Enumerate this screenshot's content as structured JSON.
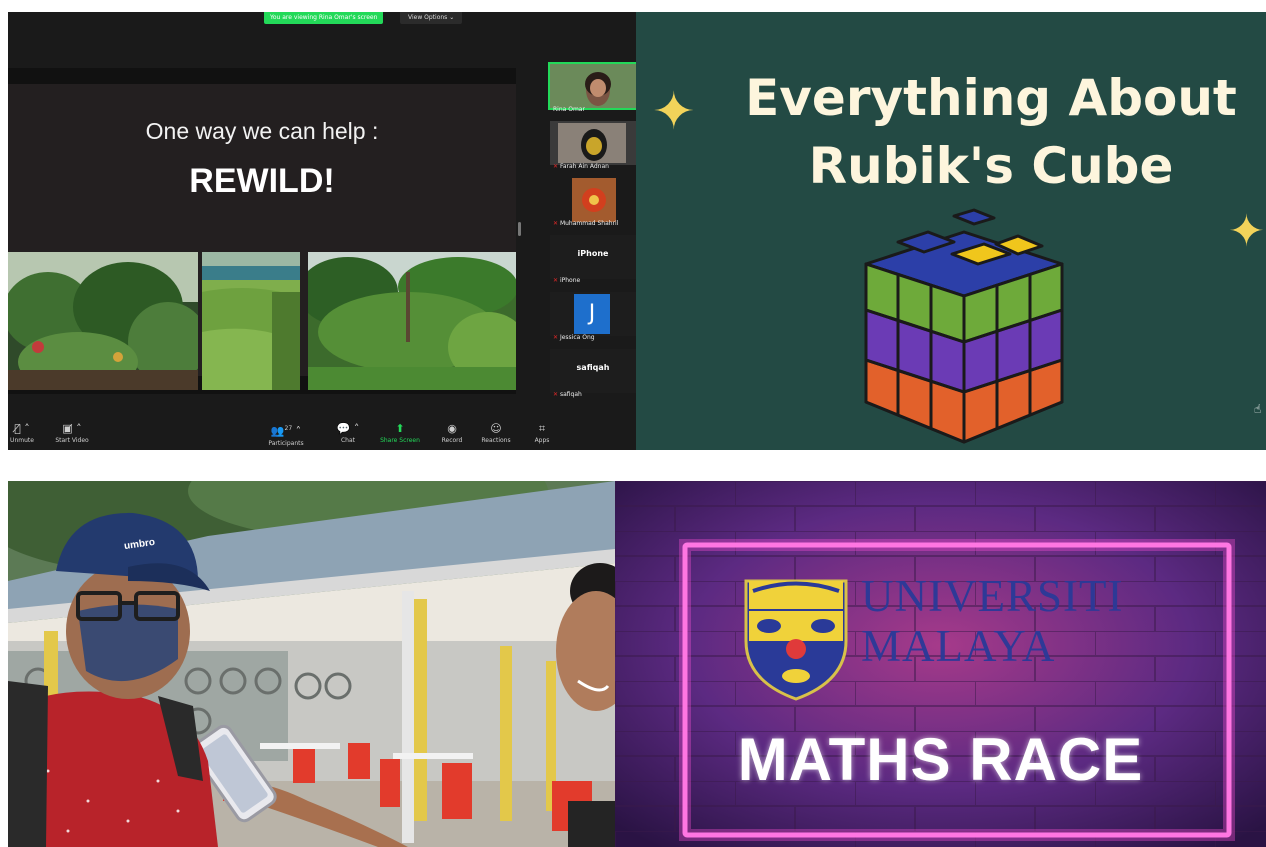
{
  "zoom": {
    "viewing_banner": "You are viewing Rina Omar's screen",
    "view_options": "View Options",
    "slide": {
      "subtitle": "One way we can help :",
      "title": "REWILD!"
    },
    "participants": [
      {
        "name": "Rina Omar",
        "type": "video",
        "active": true
      },
      {
        "name": "Farah Ain Adnan",
        "type": "video"
      },
      {
        "name": "Muhammad Shahril",
        "type": "video"
      },
      {
        "name": "iPhone",
        "type": "text",
        "display": "iPhone"
      },
      {
        "name": "Jessica Ong",
        "type": "avatar",
        "initial": "J"
      },
      {
        "name": "safiqah",
        "type": "text",
        "display": "safiqah"
      }
    ],
    "toolbar": {
      "unmute": "Unmute",
      "start_video": "Start Video",
      "participants": "Participants",
      "participants_count": "27",
      "chat": "Chat",
      "share_screen": "Share Screen",
      "record": "Record",
      "reactions": "Reactions",
      "apps": "Apps"
    },
    "accent": "#23d959"
  },
  "rubik": {
    "title_line1": "Everything About",
    "title_line2": "Rubik's Cube",
    "background": "#234a44",
    "sparkle_color": "#f2d35a"
  },
  "interview": {
    "cap_brand": "umbro"
  },
  "maths": {
    "university_line1": "UNIVERSITI",
    "university_line2": "MALAYA",
    "title": "MATHS RACE",
    "neon_color": "#ff4fd8"
  }
}
